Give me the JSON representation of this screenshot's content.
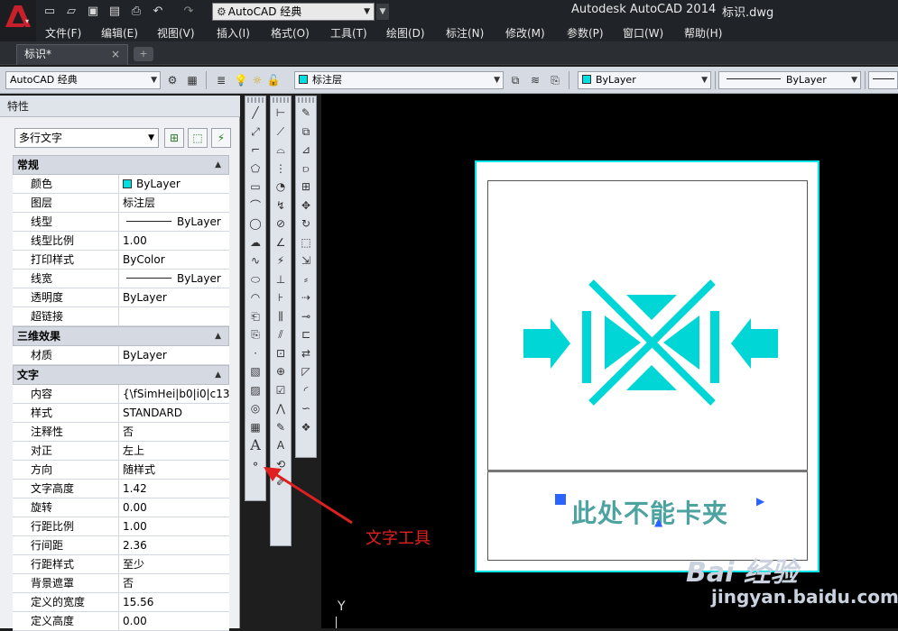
{
  "title_bar": {
    "workspace": "AutoCAD 经典",
    "app_name": "Autodesk AutoCAD 2014",
    "file_name": "标识.dwg"
  },
  "menu": [
    "文件(F)",
    "编辑(E)",
    "视图(V)",
    "插入(I)",
    "格式(O)",
    "工具(T)",
    "绘图(D)",
    "标注(N)",
    "修改(M)",
    "参数(P)",
    "窗口(W)",
    "帮助(H)"
  ],
  "tabs": {
    "active": "标识*"
  },
  "toolbar": {
    "workspace": "AutoCAD 经典",
    "layer": "标注层",
    "color": "ByLayer",
    "linetype": "ByLayer"
  },
  "properties": {
    "header": "特性",
    "object_type": "多行文字",
    "sections": [
      {
        "title": "常规",
        "rows": [
          {
            "k": "颜色",
            "v": "ByLayer"
          },
          {
            "k": "图层",
            "v": "标注层"
          },
          {
            "k": "线型",
            "v": "ByLayer"
          },
          {
            "k": "线型比例",
            "v": "1.00"
          },
          {
            "k": "打印样式",
            "v": "ByColor"
          },
          {
            "k": "线宽",
            "v": "ByLayer"
          },
          {
            "k": "透明度",
            "v": "ByLayer"
          },
          {
            "k": "超链接",
            "v": ""
          }
        ]
      },
      {
        "title": "三维效果",
        "rows": [
          {
            "k": "材质",
            "v": "ByLayer"
          }
        ]
      },
      {
        "title": "文字",
        "rows": [
          {
            "k": "内容",
            "v": "{\\fSimHei|b0|i0|c13..."
          },
          {
            "k": "样式",
            "v": "STANDARD"
          },
          {
            "k": "注释性",
            "v": "否"
          },
          {
            "k": "对正",
            "v": "左上"
          },
          {
            "k": "方向",
            "v": "随样式"
          },
          {
            "k": "文字高度",
            "v": "1.42"
          },
          {
            "k": "旋转",
            "v": "0.00"
          },
          {
            "k": "行距比例",
            "v": "1.00"
          },
          {
            "k": "行间距",
            "v": "2.36"
          },
          {
            "k": "行距样式",
            "v": "至少"
          },
          {
            "k": "背景遮罩",
            "v": "否"
          },
          {
            "k": "定义的宽度",
            "v": "15.56"
          },
          {
            "k": "定义高度",
            "v": "0.00"
          }
        ]
      }
    ]
  },
  "drawing": {
    "sign_text": "此处不能卡夹",
    "ucs_label": "Y"
  },
  "annotation": {
    "callout": "文字工具"
  },
  "watermark": {
    "logo": "Bai 经验",
    "url": "jingyan.baidu.com"
  },
  "colors": {
    "accent_cyan": "#00e5e5",
    "callout_red": "#e02020"
  }
}
